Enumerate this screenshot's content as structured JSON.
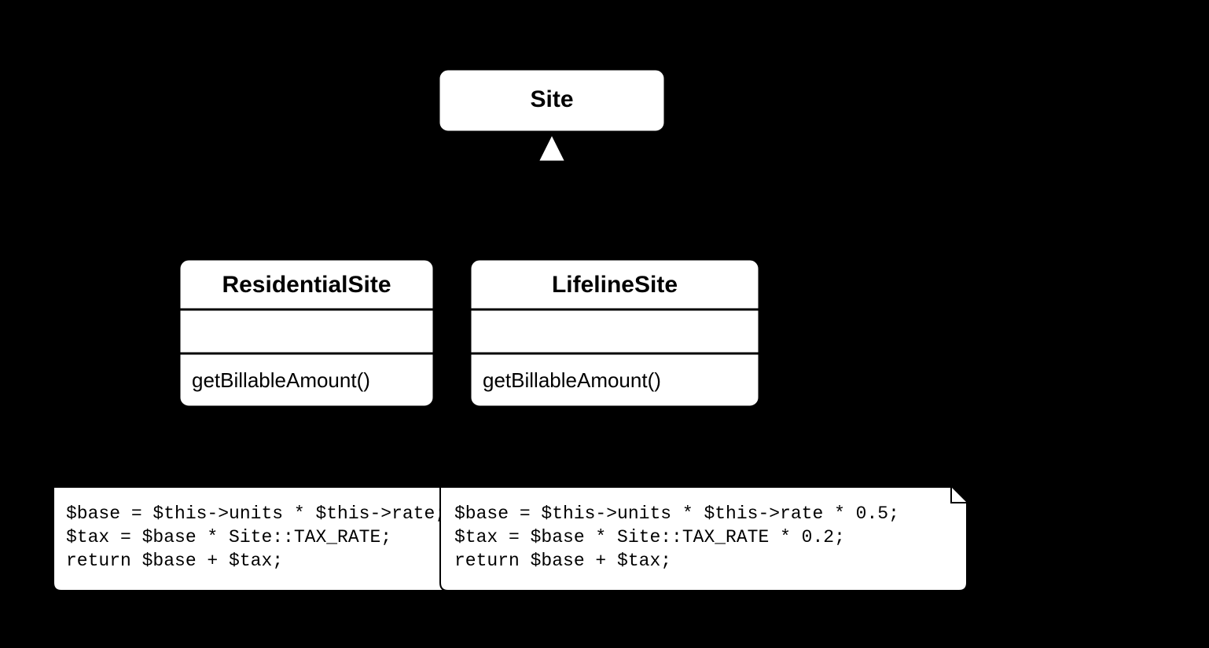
{
  "parent": {
    "name": "Site"
  },
  "children": [
    {
      "name": "ResidentialSite",
      "method": "getBillableAmount()",
      "note_lines": [
        "$base = $this->units * $this->rate;",
        "$tax = $base * Site::TAX_RATE;",
        "return $base + $tax;"
      ]
    },
    {
      "name": "LifelineSite",
      "method": "getBillableAmount()",
      "note_lines": [
        "$base = $this->units * $this->rate * 0.5;",
        "$tax = $base * Site::TAX_RATE * 0.2;",
        "return $base + $tax;"
      ]
    }
  ]
}
